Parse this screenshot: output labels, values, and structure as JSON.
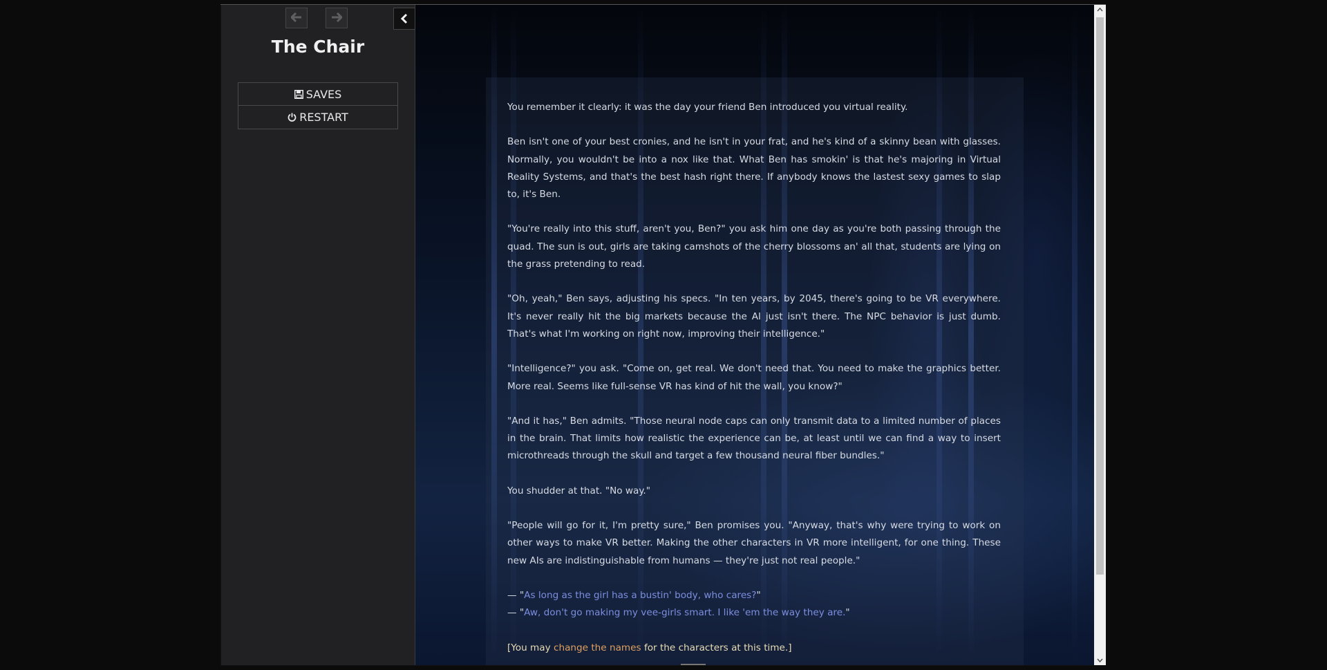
{
  "sidebar": {
    "back_icon": "arrow-left-icon",
    "forward_icon": "arrow-right-icon",
    "collapse_icon": "chevron-left-icon",
    "story_title": "The Chair",
    "menu": {
      "saves_label": "SAVES",
      "saves_icon": "floppy-disk-icon",
      "restart_label": "RESTART",
      "restart_icon": "power-icon"
    }
  },
  "passage": {
    "paragraphs": [
      "You remember it clearly: it was the day your friend Ben introduced you virtual reality.",
      "Ben isn't one of your best cronies, and he isn't in your frat, and he's kind of a skinny bean with glasses. Normally, you wouldn't be into a nox like that. What Ben has smokin' is that he's majoring in Virtual Reality Systems, and that's the best hash right there. If anybody knows the lastest sexy games to slap to, it's Ben.",
      "\"You're really into this stuff, aren't you, Ben?\" you ask him one day as you're both passing through the quad. The sun is out, girls are taking camshots of the cherry blossoms an' all that, students are lying on the grass pretending to read.",
      "\"Oh, yeah,\" Ben says, adjusting his specs. \"In ten years, by 2045, there's going to be VR everywhere. It's never really hit the big markets because the AI just isn't there. The NPC behavior is just dumb. That's what I'm working on right now, improving their intelligence.\"",
      "\"Intelligence?\" you ask. \"Come on, get real. We don't need that. You need to make the graphics better. More real. Seems like full-sense VR has kind of hit the wall, you know?\"",
      "\"And it has,\" Ben admits. \"Those neural node caps can only transmit data to a limited number of places in the brain. That limits how realistic the experience can be, at least until we can find a way to insert microthreads through the skull and target a few thousand neural fiber bundles.\"",
      "You shudder at that. \"No way.\"",
      "\"People will go for it, I'm pretty sure,\" Ben promises you. \"Anyway, that's why were trying to work on other ways to make VR better. Making the other characters in VR more intelligent, for one thing. These new AIs are indistinguishable from humans — they're just not real people.\""
    ],
    "choices": {
      "prefix": "— \"",
      "suffix": "\"",
      "items": [
        "As long as the girl has a bustin' body, who cares?",
        "Aw, don't go making my vee-girls smart. I like 'em the way they are."
      ]
    },
    "note": {
      "before": "[You may ",
      "link": "change the names",
      "after": " for the characters at this time.]"
    }
  },
  "colors": {
    "sidebar_bg": "#212123",
    "choice_link": "#7c8ee0",
    "note_text": "#e8dcb4",
    "note_link": "#e0a060"
  }
}
